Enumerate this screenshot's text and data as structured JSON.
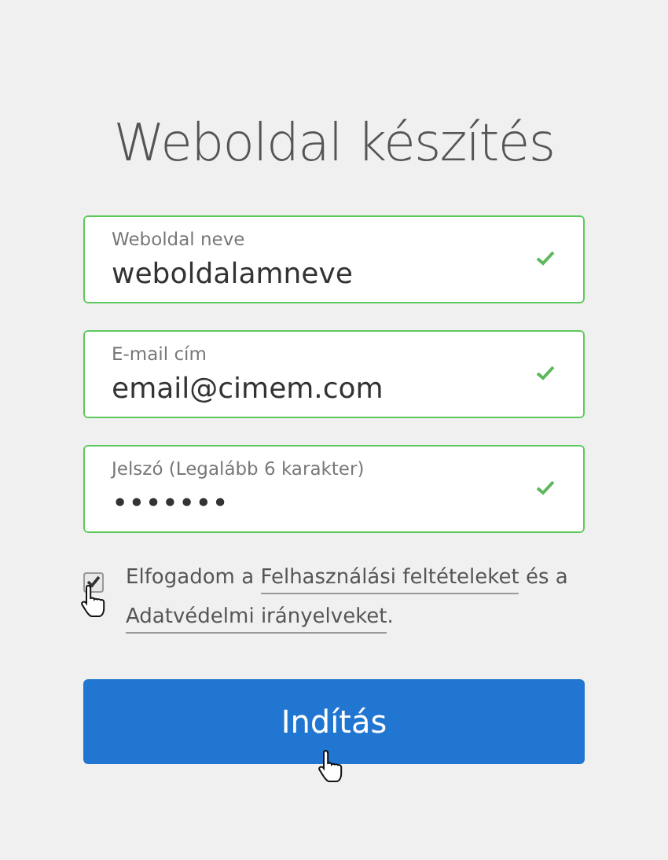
{
  "title": "Weboldal készítés",
  "fields": [
    {
      "label": "Weboldal neve",
      "value": "weboldalamneve",
      "valid": true
    },
    {
      "label": "E-mail cím",
      "value": "email@cimem.com",
      "valid": true
    },
    {
      "label": "Jelszó (Legalább 6 karakter)",
      "value": "•••••••",
      "valid": true
    }
  ],
  "consent": {
    "checked": true,
    "parts": [
      {
        "kind": "text",
        "text": "Elfogadom a "
      },
      {
        "kind": "link",
        "text": "Felhasználási feltételeket"
      },
      {
        "kind": "text",
        "text": " és a "
      },
      {
        "kind": "link",
        "text": "Adatvédelmi irányelveket"
      },
      {
        "kind": "text",
        "text": "."
      }
    ]
  },
  "submit": {
    "label": "Indítás"
  }
}
